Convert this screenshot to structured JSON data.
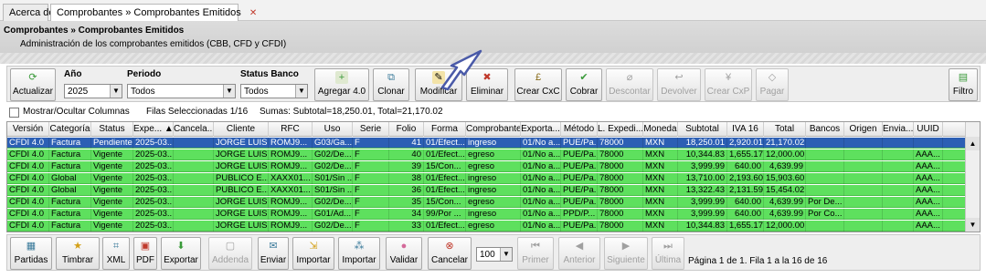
{
  "tabs": [
    {
      "label": "Acerca de"
    },
    {
      "label": "Comprobantes » Comprobantes Emitidos",
      "close": "✕"
    }
  ],
  "header": {
    "title": "Comprobantes » Comprobantes Emitidos",
    "subtitle": "Administración de los comprobantes emitidos (CBB, CFD y CFDI)"
  },
  "toolbar": {
    "actualizar": "Actualizar",
    "anio_label": "Año",
    "anio_value": "2025",
    "periodo_label": "Periodo",
    "periodo_value": "Todos",
    "status_label": "Status Banco",
    "status_value": "Todos",
    "agregar": "Agregar 4.0",
    "clonar": "Clonar",
    "modificar": "Modificar",
    "eliminar": "Eliminar",
    "crear_cxc": "Crear CxC",
    "cobrar": "Cobrar",
    "descontar": "Descontar",
    "devolver": "Devolver",
    "crear_cxp": "Crear CxP",
    "pagar": "Pagar",
    "filtro": "Filtro"
  },
  "info": {
    "mostrar": "Mostrar/Ocultar Columnas",
    "filas": "Filas Seleccionadas  1/16",
    "sumas": "Sumas:  Subtotal=18,250.01, Total=21,170.02"
  },
  "grid": {
    "columns": [
      "Versión",
      "Categoría",
      "Status",
      "Expe... ▲",
      "Cancela...",
      "Cliente",
      "RFC",
      "Uso",
      "Serie",
      "Folio",
      "Forma",
      "Comprobante",
      "Exporta...",
      "Método",
      "L. Expedi...",
      "Moneda",
      "Subtotal",
      "IVA 16",
      "Total",
      "Bancos",
      "Origen",
      "Envia...",
      "UUID"
    ],
    "rows": [
      [
        "CFDI 4.0",
        "Factura",
        "Pendiente",
        "2025-03...",
        "",
        "JORGE LUIS...",
        "ROMJ9...",
        "G03/Ga...",
        "F",
        "41",
        "01/Efect...",
        "ingreso",
        "01/No a...",
        "PUE/Pa...",
        "78000",
        "MXN",
        "18,250.01",
        "2,920.01",
        "21,170.02",
        "",
        "",
        "",
        ""
      ],
      [
        "CFDI 4.0",
        "Factura",
        "Vigente",
        "2025-03...",
        "",
        "JORGE LUIS...",
        "ROMJ9...",
        "G02/De...",
        "F",
        "40",
        "01/Efect...",
        "egreso",
        "01/No a...",
        "PUE/Pa...",
        "78000",
        "MXN",
        "10,344.83",
        "1,655.17",
        "12,000.00",
        "",
        "",
        "",
        "AAA..."
      ],
      [
        "CFDI 4.0",
        "Factura",
        "Vigente",
        "2025-03...",
        "",
        "JORGE LUIS...",
        "ROMJ9...",
        "G02/De...",
        "F",
        "39",
        "15/Con...",
        "egreso",
        "01/No a...",
        "PUE/Pa...",
        "78000",
        "MXN",
        "3,999.99",
        "640.00",
        "4,639.99",
        "",
        "",
        "",
        "AAA..."
      ],
      [
        "CFDI 4.0",
        "Global",
        "Vigente",
        "2025-03...",
        "",
        "PUBLICO E...",
        "XAXX01...",
        "S01/Sin ...",
        "F",
        "38",
        "01/Efect...",
        "ingreso",
        "01/No a...",
        "PUE/Pa...",
        "78000",
        "MXN",
        "13,710.00",
        "2,193.60",
        "15,903.60",
        "",
        "",
        "",
        "AAA..."
      ],
      [
        "CFDI 4.0",
        "Global",
        "Vigente",
        "2025-03...",
        "",
        "PUBLICO E...",
        "XAXX01...",
        "S01/Sin ...",
        "F",
        "36",
        "01/Efect...",
        "ingreso",
        "01/No a...",
        "PUE/Pa...",
        "78000",
        "MXN",
        "13,322.43",
        "2,131.59",
        "15,454.02",
        "",
        "",
        "",
        "AAA..."
      ],
      [
        "CFDI 4.0",
        "Factura",
        "Vigente",
        "2025-03...",
        "",
        "JORGE LUIS...",
        "ROMJ9...",
        "G02/De...",
        "F",
        "35",
        "15/Con...",
        "egreso",
        "01/No a...",
        "PUE/Pa...",
        "78000",
        "MXN",
        "3,999.99",
        "640.00",
        "4,639.99",
        "Por De...",
        "",
        "",
        "AAA..."
      ],
      [
        "CFDI 4.0",
        "Factura",
        "Vigente",
        "2025-03...",
        "",
        "JORGE LUIS...",
        "ROMJ9...",
        "G01/Ad...",
        "F",
        "34",
        "99/Por ...",
        "ingreso",
        "01/No a...",
        "PPD/P...",
        "78000",
        "MXN",
        "3,999.99",
        "640.00",
        "4,639.99",
        "Por Co...",
        "",
        "",
        "AAA..."
      ],
      [
        "CFDI 4.0",
        "Factura",
        "Vigente",
        "2025-03...",
        "",
        "JORGE LUIS...",
        "ROMJ9...",
        "G02/De...",
        "F",
        "33",
        "01/Efect...",
        "egreso",
        "01/No a...",
        "PUE/Pa...",
        "78000",
        "MXN",
        "10,344.83",
        "1,655.17",
        "12,000.00",
        "",
        "",
        "",
        "AAA..."
      ]
    ]
  },
  "bottom": {
    "partidas": "Partidas",
    "timbrar": "Timbrar",
    "xml": "XML",
    "pdf": "PDF",
    "exportar": "Exportar",
    "addenda": "Addenda",
    "enviar": "Enviar",
    "importar1": "Importar",
    "importar2": "Importar",
    "validar": "Validar",
    "cancelar": "Cancelar",
    "page_size": "100",
    "primer": "Primer",
    "anterior": "Anterior",
    "siguiente": "Siguiente",
    "ultima": "Última",
    "page_info": "Página 1 de 1. Fila 1 a la 16 de 16"
  },
  "colors": {
    "row_green": "#5ee05e",
    "row_selected": "#2c5fb4",
    "icon_green": "#3a9a3a",
    "icon_red": "#c0392b"
  }
}
